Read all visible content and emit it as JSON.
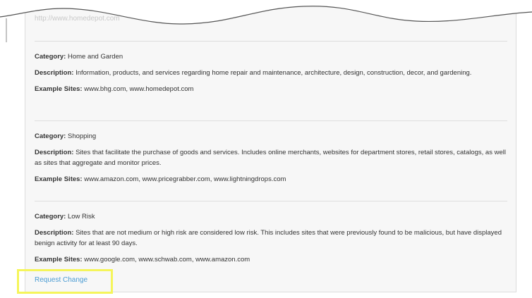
{
  "faded_url": "http://www.homedepot.com",
  "entries": [
    {
      "category_label": "Category:",
      "category": "Home and Garden",
      "description_label": "Description:",
      "description": "Information, products, and services regarding home repair and maintenance, architecture, design, construction, decor, and gardening.",
      "examples_label": "Example Sites:",
      "examples": "www.bhg.com, www.homedepot.com"
    },
    {
      "category_label": "Category:",
      "category": "Shopping",
      "description_label": "Description:",
      "description": "Sites that facilitate the purchase of goods and services. Includes online merchants, websites for department stores, retail stores, catalogs, as well as sites that aggregate and monitor prices.",
      "examples_label": "Example Sites:",
      "examples": "www.amazon.com, www.pricegrabber.com, www.lightningdrops.com"
    },
    {
      "category_label": "Category:",
      "category": "Low Risk",
      "description_label": "Description:",
      "description": "Sites that are not medium or high risk are considered low risk. This includes sites that were previously found to be malicious, but have displayed benign activity for at least 90 days.",
      "examples_label": "Example Sites:",
      "examples": "www.google.com, www.schwab.com, www.amazon.com"
    }
  ],
  "request_change_label": "Request Change",
  "colors": {
    "link": "#4b9cd3",
    "highlight": "#f5f55a",
    "panel_bg": "#f7f7f7"
  }
}
